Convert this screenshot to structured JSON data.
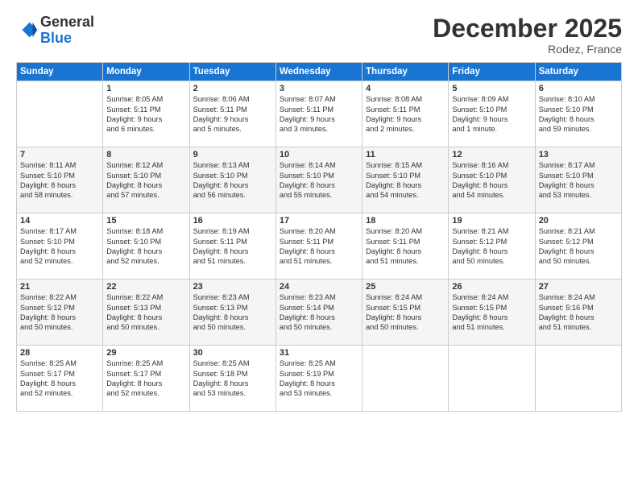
{
  "logo": {
    "line1": "General",
    "line2": "Blue"
  },
  "title": "December 2025",
  "location": "Rodez, France",
  "days_header": [
    "Sunday",
    "Monday",
    "Tuesday",
    "Wednesday",
    "Thursday",
    "Friday",
    "Saturday"
  ],
  "weeks": [
    [
      {
        "num": "",
        "info": ""
      },
      {
        "num": "1",
        "info": "Sunrise: 8:05 AM\nSunset: 5:11 PM\nDaylight: 9 hours\nand 6 minutes."
      },
      {
        "num": "2",
        "info": "Sunrise: 8:06 AM\nSunset: 5:11 PM\nDaylight: 9 hours\nand 5 minutes."
      },
      {
        "num": "3",
        "info": "Sunrise: 8:07 AM\nSunset: 5:11 PM\nDaylight: 9 hours\nand 3 minutes."
      },
      {
        "num": "4",
        "info": "Sunrise: 8:08 AM\nSunset: 5:11 PM\nDaylight: 9 hours\nand 2 minutes."
      },
      {
        "num": "5",
        "info": "Sunrise: 8:09 AM\nSunset: 5:10 PM\nDaylight: 9 hours\nand 1 minute."
      },
      {
        "num": "6",
        "info": "Sunrise: 8:10 AM\nSunset: 5:10 PM\nDaylight: 8 hours\nand 59 minutes."
      }
    ],
    [
      {
        "num": "7",
        "info": "Sunrise: 8:11 AM\nSunset: 5:10 PM\nDaylight: 8 hours\nand 58 minutes."
      },
      {
        "num": "8",
        "info": "Sunrise: 8:12 AM\nSunset: 5:10 PM\nDaylight: 8 hours\nand 57 minutes."
      },
      {
        "num": "9",
        "info": "Sunrise: 8:13 AM\nSunset: 5:10 PM\nDaylight: 8 hours\nand 56 minutes."
      },
      {
        "num": "10",
        "info": "Sunrise: 8:14 AM\nSunset: 5:10 PM\nDaylight: 8 hours\nand 55 minutes."
      },
      {
        "num": "11",
        "info": "Sunrise: 8:15 AM\nSunset: 5:10 PM\nDaylight: 8 hours\nand 54 minutes."
      },
      {
        "num": "12",
        "info": "Sunrise: 8:16 AM\nSunset: 5:10 PM\nDaylight: 8 hours\nand 54 minutes."
      },
      {
        "num": "13",
        "info": "Sunrise: 8:17 AM\nSunset: 5:10 PM\nDaylight: 8 hours\nand 53 minutes."
      }
    ],
    [
      {
        "num": "14",
        "info": "Sunrise: 8:17 AM\nSunset: 5:10 PM\nDaylight: 8 hours\nand 52 minutes."
      },
      {
        "num": "15",
        "info": "Sunrise: 8:18 AM\nSunset: 5:10 PM\nDaylight: 8 hours\nand 52 minutes."
      },
      {
        "num": "16",
        "info": "Sunrise: 8:19 AM\nSunset: 5:11 PM\nDaylight: 8 hours\nand 51 minutes."
      },
      {
        "num": "17",
        "info": "Sunrise: 8:20 AM\nSunset: 5:11 PM\nDaylight: 8 hours\nand 51 minutes."
      },
      {
        "num": "18",
        "info": "Sunrise: 8:20 AM\nSunset: 5:11 PM\nDaylight: 8 hours\nand 51 minutes."
      },
      {
        "num": "19",
        "info": "Sunrise: 8:21 AM\nSunset: 5:12 PM\nDaylight: 8 hours\nand 50 minutes."
      },
      {
        "num": "20",
        "info": "Sunrise: 8:21 AM\nSunset: 5:12 PM\nDaylight: 8 hours\nand 50 minutes."
      }
    ],
    [
      {
        "num": "21",
        "info": "Sunrise: 8:22 AM\nSunset: 5:12 PM\nDaylight: 8 hours\nand 50 minutes."
      },
      {
        "num": "22",
        "info": "Sunrise: 8:22 AM\nSunset: 5:13 PM\nDaylight: 8 hours\nand 50 minutes."
      },
      {
        "num": "23",
        "info": "Sunrise: 8:23 AM\nSunset: 5:13 PM\nDaylight: 8 hours\nand 50 minutes."
      },
      {
        "num": "24",
        "info": "Sunrise: 8:23 AM\nSunset: 5:14 PM\nDaylight: 8 hours\nand 50 minutes."
      },
      {
        "num": "25",
        "info": "Sunrise: 8:24 AM\nSunset: 5:15 PM\nDaylight: 8 hours\nand 50 minutes."
      },
      {
        "num": "26",
        "info": "Sunrise: 8:24 AM\nSunset: 5:15 PM\nDaylight: 8 hours\nand 51 minutes."
      },
      {
        "num": "27",
        "info": "Sunrise: 8:24 AM\nSunset: 5:16 PM\nDaylight: 8 hours\nand 51 minutes."
      }
    ],
    [
      {
        "num": "28",
        "info": "Sunrise: 8:25 AM\nSunset: 5:17 PM\nDaylight: 8 hours\nand 52 minutes."
      },
      {
        "num": "29",
        "info": "Sunrise: 8:25 AM\nSunset: 5:17 PM\nDaylight: 8 hours\nand 52 minutes."
      },
      {
        "num": "30",
        "info": "Sunrise: 8:25 AM\nSunset: 5:18 PM\nDaylight: 8 hours\nand 53 minutes."
      },
      {
        "num": "31",
        "info": "Sunrise: 8:25 AM\nSunset: 5:19 PM\nDaylight: 8 hours\nand 53 minutes."
      },
      {
        "num": "",
        "info": ""
      },
      {
        "num": "",
        "info": ""
      },
      {
        "num": "",
        "info": ""
      }
    ]
  ]
}
